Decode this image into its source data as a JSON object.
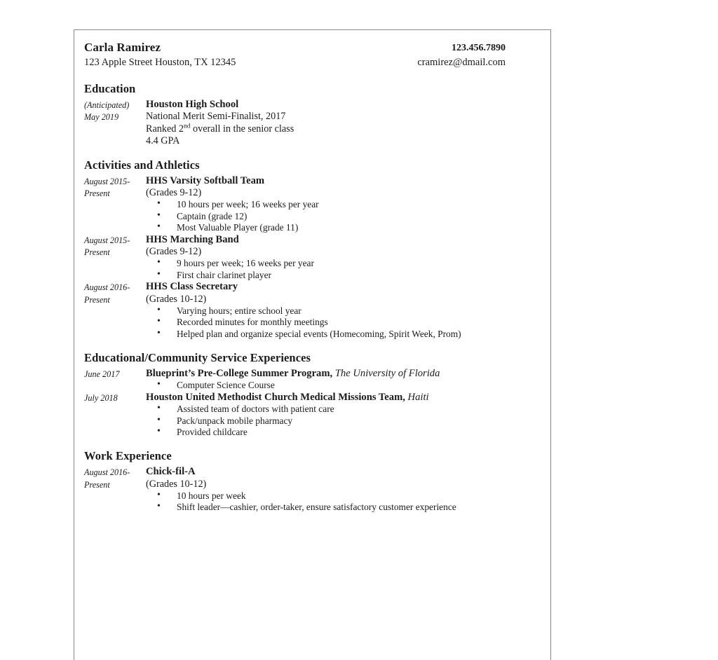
{
  "document": {
    "header": {
      "name": "Carla Ramirez",
      "address": "123 Apple Street Houston, TX 12345",
      "phone": "123.456.7890",
      "email": "cramirez@dmail.com"
    },
    "sections": [
      {
        "title": "Education",
        "entries": [
          {
            "date_line1": "(Anticipated)",
            "date_line2": "May 2019",
            "title": "Houston High School",
            "org": "",
            "sublines": [
              "National Merit Semi-Finalist, 2017",
              "Ranked 2nd overall in the senior class",
              "4.4 GPA"
            ],
            "bullets": []
          }
        ]
      },
      {
        "title": "Activities and Athletics",
        "entries": [
          {
            "date_line1": "August 2015-",
            "date_line2": "Present",
            "title": "HHS Varsity Softball Team",
            "org": "",
            "sublines": [
              "(Grades 9-12)"
            ],
            "bullets": [
              "10 hours per week; 16 weeks per year",
              "Captain (grade 12)",
              "Most Valuable Player (grade 11)"
            ]
          },
          {
            "date_line1": "August 2015-",
            "date_line2": "Present",
            "title": "HHS Marching Band",
            "org": "",
            "sublines": [
              "(Grades 9-12)"
            ],
            "bullets": [
              "9 hours per week; 16 weeks per year",
              "First chair clarinet player"
            ]
          },
          {
            "date_line1": "August 2016-",
            "date_line2": "Present",
            "title": "HHS Class Secretary",
            "org": "",
            "sublines": [
              "(Grades 10-12)"
            ],
            "bullets": [
              "Varying hours; entire school year",
              "Recorded minutes for monthly meetings",
              "Helped plan and organize special events (Homecoming, Spirit Week, Prom)"
            ]
          }
        ]
      },
      {
        "title": "Educational/Community Service Experiences",
        "entries": [
          {
            "date_line1": "June 2017",
            "date_line2": "",
            "title": "Blueprint’s Pre-College Summer Program,",
            "org": "The University of Florida",
            "sublines": [],
            "bullets": [
              "Computer Science Course"
            ]
          },
          {
            "date_line1": "July 2018",
            "date_line2": "",
            "title": "Houston United Methodist Church Medical Missions Team,",
            "org": "Haiti",
            "sublines": [],
            "bullets": [
              "Assisted team of doctors with patient care",
              "Pack/unpack mobile pharmacy",
              "Provided childcare"
            ]
          }
        ]
      },
      {
        "title": "Work Experience",
        "entries": [
          {
            "date_line1": "August 2016-",
            "date_line2": "Present",
            "title": "Chick-fil-A",
            "org": "",
            "sublines": [
              "(Grades 10-12)"
            ],
            "bullets": [
              "10 hours per week",
              "Shift leader—cashier, order-taker, ensure satisfactory customer experience"
            ]
          }
        ]
      }
    ]
  }
}
